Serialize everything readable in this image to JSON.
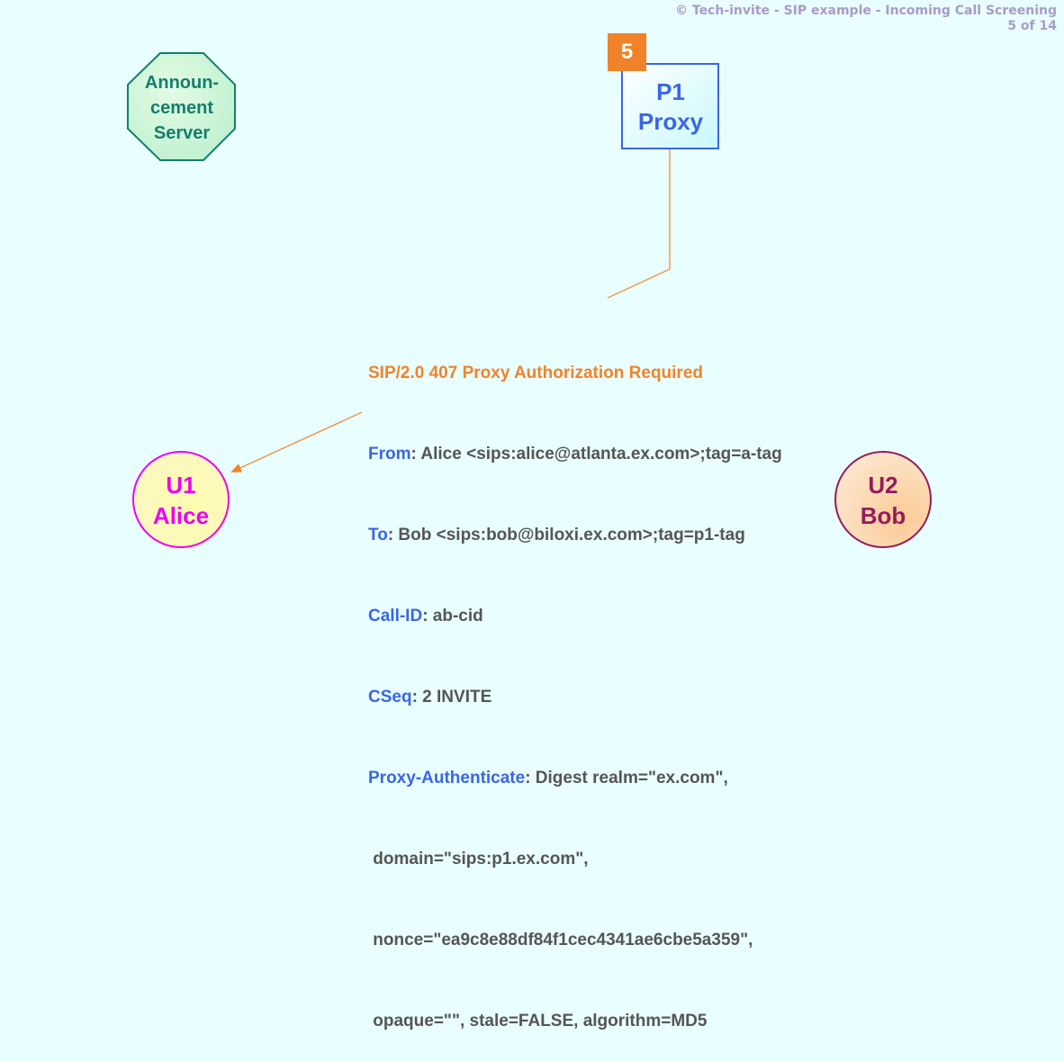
{
  "header": {
    "copyright_line": "© Tech-invite - SIP example - Incoming Call Screening",
    "page_indicator": "5 of 14"
  },
  "step_number": "5",
  "nodes": {
    "announcement_server": {
      "line1": "Announ-",
      "line2": "cement",
      "line3": "Server"
    },
    "proxy": {
      "line1": "P1",
      "line2": "Proxy"
    },
    "alice": {
      "line1": "U1",
      "line2": "Alice"
    },
    "bob": {
      "line1": "U2",
      "line2": "Bob"
    }
  },
  "message": {
    "status_line": "SIP/2.0 407 Proxy Authorization Required",
    "headers": [
      {
        "name": "From",
        "value": ": Alice <sips:alice@atlanta.ex.com>;tag=a-tag"
      },
      {
        "name": "To",
        "value": ": Bob <sips:bob@biloxi.ex.com>;tag=p1-tag"
      },
      {
        "name": "Call-ID",
        "value": ": ab-cid"
      },
      {
        "name": "CSeq",
        "value": ": 2 INVITE"
      },
      {
        "name": "Proxy-Authenticate",
        "value": ": Digest realm=\"ex.com\","
      }
    ],
    "continuation_lines": [
      " domain=\"sips:p1.ex.com\",",
      " nonce=\"ea9c8e88df84f1cec4341ae6cbe5a359\",",
      " opaque=\"\", stale=FALSE, algorithm=MD5"
    ]
  },
  "colors": {
    "background": "#e9fefe",
    "status_line": "#f0832a",
    "header_name": "#3a66e6",
    "header_value": "#555555",
    "arrow": "#f0832a",
    "announcement_border": "#127f6e",
    "proxy_border": "#3a66e6",
    "alice_border": "#ee00ee",
    "bob_border": "#951c5c"
  }
}
